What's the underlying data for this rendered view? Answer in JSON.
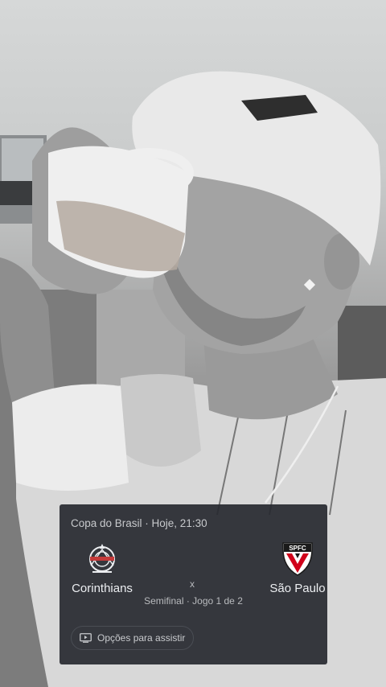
{
  "match_card": {
    "header": "Copa do Brasil · Hoje, 21:30",
    "home_team": {
      "name": "Corinthians",
      "crest": "corinthians-crest-icon"
    },
    "away_team": {
      "name": "São Paulo",
      "crest": "spfc-crest-icon",
      "crest_text": "SPFC"
    },
    "separator": "x",
    "stage": "Semifinal · Jogo 1 de 2",
    "watch_button": {
      "label": "Opções para assistir",
      "icon": "tv-play-icon"
    }
  },
  "colors": {
    "card_background": "#282a30",
    "card_text": "#e8eaed",
    "spfc_red": "#d0021b"
  }
}
